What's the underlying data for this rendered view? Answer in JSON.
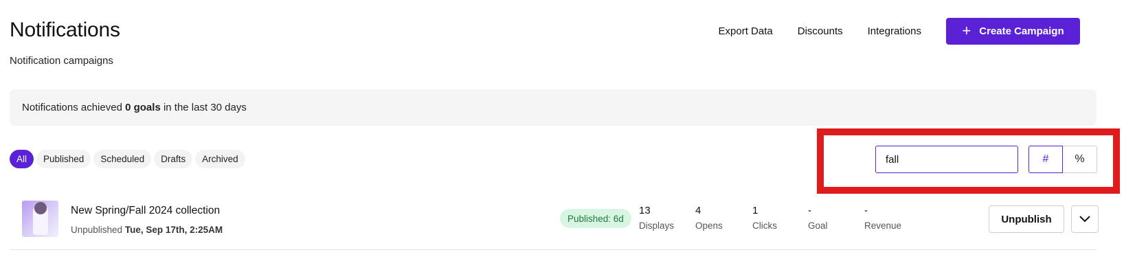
{
  "header": {
    "title": "Notifications",
    "subtitle": "Notification campaigns",
    "links": [
      "Export Data",
      "Discounts",
      "Integrations"
    ],
    "create_label": "Create Campaign"
  },
  "goals_banner": {
    "prefix": "Notifications achieved ",
    "highlight": "0 goals",
    "suffix": " in the last 30 days"
  },
  "filters": {
    "tabs": [
      "All",
      "Published",
      "Scheduled",
      "Drafts",
      "Archived"
    ],
    "active_tab": "All",
    "search_value": "fall",
    "toggle_options": [
      "#",
      "%"
    ],
    "toggle_active": "#"
  },
  "campaigns": [
    {
      "title": "New Spring/Fall 2024 collection",
      "meta_label": "Unpublished",
      "meta_date": "Tue, Sep 17th, 2:25AM",
      "status": "Published: 6d",
      "metrics": [
        {
          "value": "13",
          "label": "Displays"
        },
        {
          "value": "4",
          "label": "Opens"
        },
        {
          "value": "1",
          "label": "Clicks"
        },
        {
          "value": "-",
          "label": "Goal"
        },
        {
          "value": "-",
          "label": "Revenue"
        }
      ],
      "action_label": "Unpublish"
    }
  ],
  "colors": {
    "accent": "#5b21d6",
    "highlight_annotation": "#e01b1b",
    "status_bg": "#d8f5e2",
    "status_text": "#1d7a3e"
  },
  "icons": {
    "create": "plus-icon",
    "more": "chevron-down-icon"
  }
}
